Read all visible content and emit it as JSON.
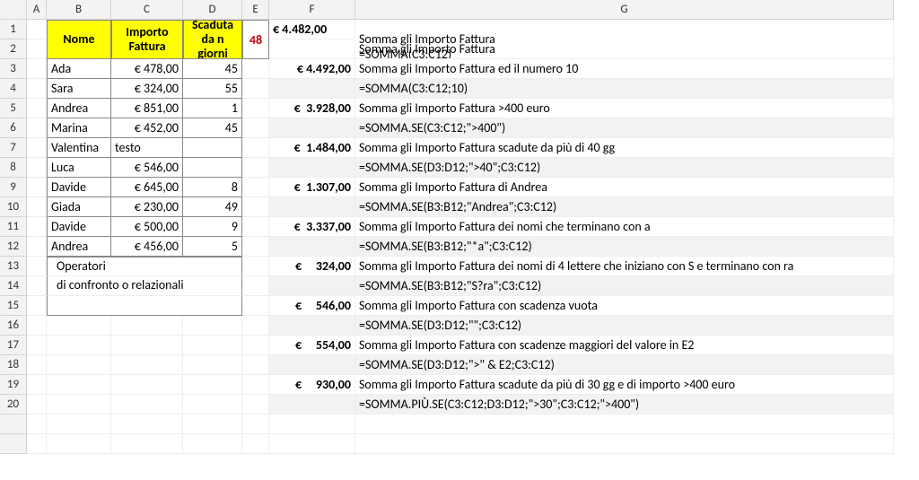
{
  "cols": [
    "A",
    "B",
    "C",
    "D",
    "E",
    "F",
    "G"
  ],
  "rows": [
    "1",
    "2",
    "3",
    "4",
    "5",
    "6",
    "7",
    "8",
    "9",
    "10",
    "11",
    "12",
    "13",
    "14",
    "15",
    "16",
    "17",
    "18",
    "19",
    "20"
  ],
  "header": {
    "nome": "Nome",
    "importo": "Importo Fattura",
    "scaduta": "Scaduta da n giorni",
    "e2": "48"
  },
  "table": [
    {
      "nome": "Ada",
      "importo": "€ 478,00",
      "giorni": "45"
    },
    {
      "nome": "Sara",
      "importo": "€ 324,00",
      "giorni": "55"
    },
    {
      "nome": "Andrea",
      "importo": "€ 851,00",
      "giorni": "1"
    },
    {
      "nome": "Marina",
      "importo": "€ 452,00",
      "giorni": "45"
    },
    {
      "nome": "Valentina",
      "importo": "testo",
      "giorni": ""
    },
    {
      "nome": "Luca",
      "importo": "€ 546,00",
      "giorni": ""
    },
    {
      "nome": "Davide",
      "importo": "€ 645,00",
      "giorni": "8"
    },
    {
      "nome": "Giada",
      "importo": "€ 230,00",
      "giorni": "49"
    },
    {
      "nome": "Davide",
      "importo": "€ 500,00",
      "giorni": "9"
    },
    {
      "nome": "Andrea",
      "importo": "€ 456,00",
      "giorni": "5"
    }
  ],
  "note": {
    "line1": "Operatori",
    "line2": "di confronto o relazionali"
  },
  "results": [
    {
      "val": "€ 4.482,00",
      "desc": "Somma gli Importo Fattura",
      "formula": "=SOMMA(C3:C12)"
    },
    {
      "val": "€ 4.492,00",
      "desc": "Somma gli Importo Fattura ed il numero 10",
      "formula": "=SOMMA(C3:C12;10)"
    },
    {
      "val": "€  3.928,00",
      "desc": "Somma gli Importo Fattura >400 euro",
      "formula": "=SOMMA.SE(C3:C12;\">400\")"
    },
    {
      "val": "€  1.484,00",
      "desc": "Somma gli Importo Fattura scadute da più di 40 gg",
      "formula": "=SOMMA.SE(D3:D12;\">40\";C3:C12)"
    },
    {
      "val": "€  1.307,00",
      "desc": "Somma gli Importo Fattura di Andrea",
      "formula": "=SOMMA.SE(B3:B12;\"Andrea\";C3:C12)"
    },
    {
      "val": "€  3.337,00",
      "desc": "Somma gli Importo Fattura dei nomi che terminano con a",
      "formula": "=SOMMA.SE(B3:B12;\"*a\";C3:C12)"
    },
    {
      "val": "€     324,00",
      "desc": "Somma gli Importo Fattura dei nomi di 4 lettere che iniziano con S e terminano con ra",
      "formula": "=SOMMA.SE(B3:B12;\"S?ra\";C3:C12)"
    },
    {
      "val": "€     546,00",
      "desc": "Somma gli Importo Fattura con scadenza vuota",
      "formula": "=SOMMA.SE(D3:D12;\"\";C3:C12)"
    },
    {
      "val": "€     554,00",
      "desc": "Somma gli Importo Fattura con scadenze maggiori del valore in E2",
      "formula": "=SOMMA.SE(D3:D12;\">\" & E2;C3:C12)"
    },
    {
      "val": "€     930,00",
      "desc": "Somma gli Importo Fattura scadute da più di 30 gg e di importo >400 euro",
      "formula": "=SOMMA.PIÙ.SE(C3:C12;D3:D12;\">30\";C3:C12;\">400\")"
    }
  ]
}
